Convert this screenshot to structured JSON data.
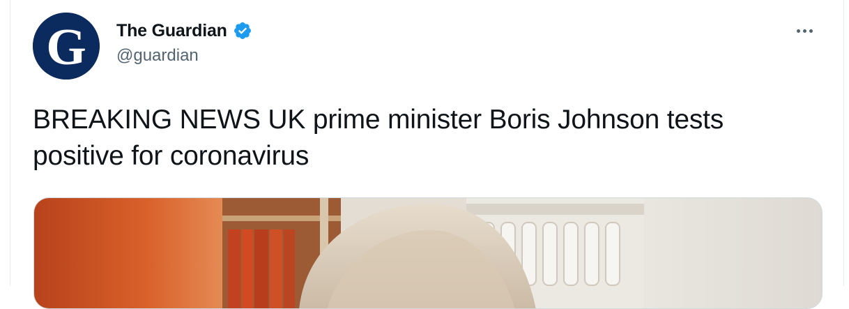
{
  "author": {
    "display_name": "The Guardian",
    "handle": "@guardian",
    "verified": true,
    "avatar_letter": "G"
  },
  "tweet": {
    "text": "BREAKING NEWS UK prime minister Boris Johnson tests positive for coronavirus"
  },
  "colors": {
    "verified_blue": "#1d9bf0",
    "avatar_navy": "#0b2a5e",
    "text_primary": "#0f1419",
    "text_secondary": "#536471"
  },
  "icons": {
    "verified": "verified-badge-icon",
    "more": "more-options-icon"
  }
}
